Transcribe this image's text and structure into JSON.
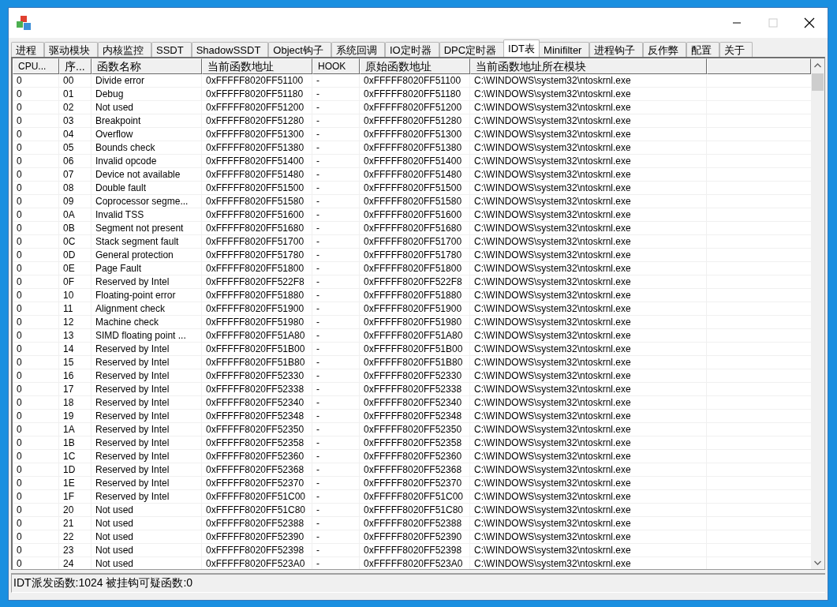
{
  "tabs": [
    {
      "label": "进程",
      "selected": false
    },
    {
      "label": "驱动模块",
      "selected": false
    },
    {
      "label": "内核监控",
      "selected": false
    },
    {
      "label": "SSDT",
      "selected": false
    },
    {
      "label": "ShadowSSDT",
      "selected": false
    },
    {
      "label": "Object钩子",
      "selected": false
    },
    {
      "label": "系统回调",
      "selected": false
    },
    {
      "label": "IO定时器",
      "selected": false
    },
    {
      "label": "DPC定时器",
      "selected": false
    },
    {
      "label": "IDT表",
      "selected": true
    },
    {
      "label": "Minifilter",
      "selected": false
    },
    {
      "label": "进程钩子",
      "selected": false
    },
    {
      "label": "反作弊",
      "selected": false
    },
    {
      "label": "配置",
      "selected": false
    },
    {
      "label": "关于",
      "selected": false
    }
  ],
  "table": {
    "columns": [
      "CPU...",
      "序...",
      "函数名称",
      "当前函数地址",
      "HOOK",
      "原始函数地址",
      "当前函数地址所在模块"
    ],
    "rows": [
      [
        "0",
        "00",
        "Divide error",
        "0xFFFFF8020FF51100",
        "-",
        "0xFFFFF8020FF51100",
        "C:\\WINDOWS\\system32\\ntoskrnl.exe"
      ],
      [
        "0",
        "01",
        "Debug",
        "0xFFFFF8020FF51180",
        "-",
        "0xFFFFF8020FF51180",
        "C:\\WINDOWS\\system32\\ntoskrnl.exe"
      ],
      [
        "0",
        "02",
        "Not used",
        "0xFFFFF8020FF51200",
        "-",
        "0xFFFFF8020FF51200",
        "C:\\WINDOWS\\system32\\ntoskrnl.exe"
      ],
      [
        "0",
        "03",
        "Breakpoint",
        "0xFFFFF8020FF51280",
        "-",
        "0xFFFFF8020FF51280",
        "C:\\WINDOWS\\system32\\ntoskrnl.exe"
      ],
      [
        "0",
        "04",
        "Overflow",
        "0xFFFFF8020FF51300",
        "-",
        "0xFFFFF8020FF51300",
        "C:\\WINDOWS\\system32\\ntoskrnl.exe"
      ],
      [
        "0",
        "05",
        "Bounds check",
        "0xFFFFF8020FF51380",
        "-",
        "0xFFFFF8020FF51380",
        "C:\\WINDOWS\\system32\\ntoskrnl.exe"
      ],
      [
        "0",
        "06",
        "Invalid opcode",
        "0xFFFFF8020FF51400",
        "-",
        "0xFFFFF8020FF51400",
        "C:\\WINDOWS\\system32\\ntoskrnl.exe"
      ],
      [
        "0",
        "07",
        "Device not available",
        "0xFFFFF8020FF51480",
        "-",
        "0xFFFFF8020FF51480",
        "C:\\WINDOWS\\system32\\ntoskrnl.exe"
      ],
      [
        "0",
        "08",
        "Double fault",
        "0xFFFFF8020FF51500",
        "-",
        "0xFFFFF8020FF51500",
        "C:\\WINDOWS\\system32\\ntoskrnl.exe"
      ],
      [
        "0",
        "09",
        "Coprocessor segme...",
        "0xFFFFF8020FF51580",
        "-",
        "0xFFFFF8020FF51580",
        "C:\\WINDOWS\\system32\\ntoskrnl.exe"
      ],
      [
        "0",
        "0A",
        "Invalid TSS",
        "0xFFFFF8020FF51600",
        "-",
        "0xFFFFF8020FF51600",
        "C:\\WINDOWS\\system32\\ntoskrnl.exe"
      ],
      [
        "0",
        "0B",
        "Segment not present",
        "0xFFFFF8020FF51680",
        "-",
        "0xFFFFF8020FF51680",
        "C:\\WINDOWS\\system32\\ntoskrnl.exe"
      ],
      [
        "0",
        "0C",
        "Stack segment fault",
        "0xFFFFF8020FF51700",
        "-",
        "0xFFFFF8020FF51700",
        "C:\\WINDOWS\\system32\\ntoskrnl.exe"
      ],
      [
        "0",
        "0D",
        "General protection",
        "0xFFFFF8020FF51780",
        "-",
        "0xFFFFF8020FF51780",
        "C:\\WINDOWS\\system32\\ntoskrnl.exe"
      ],
      [
        "0",
        "0E",
        "Page Fault",
        "0xFFFFF8020FF51800",
        "-",
        "0xFFFFF8020FF51800",
        "C:\\WINDOWS\\system32\\ntoskrnl.exe"
      ],
      [
        "0",
        "0F",
        "Reserved by Intel",
        "0xFFFFF8020FF522F8",
        "-",
        "0xFFFFF8020FF522F8",
        "C:\\WINDOWS\\system32\\ntoskrnl.exe"
      ],
      [
        "0",
        "10",
        "Floating-point error",
        "0xFFFFF8020FF51880",
        "-",
        "0xFFFFF8020FF51880",
        "C:\\WINDOWS\\system32\\ntoskrnl.exe"
      ],
      [
        "0",
        "11",
        "Alignment check",
        "0xFFFFF8020FF51900",
        "-",
        "0xFFFFF8020FF51900",
        "C:\\WINDOWS\\system32\\ntoskrnl.exe"
      ],
      [
        "0",
        "12",
        "Machine check",
        "0xFFFFF8020FF51980",
        "-",
        "0xFFFFF8020FF51980",
        "C:\\WINDOWS\\system32\\ntoskrnl.exe"
      ],
      [
        "0",
        "13",
        "SIMD floating point ...",
        "0xFFFFF8020FF51A80",
        "-",
        "0xFFFFF8020FF51A80",
        "C:\\WINDOWS\\system32\\ntoskrnl.exe"
      ],
      [
        "0",
        "14",
        "Reserved by Intel",
        "0xFFFFF8020FF51B00",
        "-",
        "0xFFFFF8020FF51B00",
        "C:\\WINDOWS\\system32\\ntoskrnl.exe"
      ],
      [
        "0",
        "15",
        "Reserved by Intel",
        "0xFFFFF8020FF51B80",
        "-",
        "0xFFFFF8020FF51B80",
        "C:\\WINDOWS\\system32\\ntoskrnl.exe"
      ],
      [
        "0",
        "16",
        "Reserved by Intel",
        "0xFFFFF8020FF52330",
        "-",
        "0xFFFFF8020FF52330",
        "C:\\WINDOWS\\system32\\ntoskrnl.exe"
      ],
      [
        "0",
        "17",
        "Reserved by Intel",
        "0xFFFFF8020FF52338",
        "-",
        "0xFFFFF8020FF52338",
        "C:\\WINDOWS\\system32\\ntoskrnl.exe"
      ],
      [
        "0",
        "18",
        "Reserved by Intel",
        "0xFFFFF8020FF52340",
        "-",
        "0xFFFFF8020FF52340",
        "C:\\WINDOWS\\system32\\ntoskrnl.exe"
      ],
      [
        "0",
        "19",
        "Reserved by Intel",
        "0xFFFFF8020FF52348",
        "-",
        "0xFFFFF8020FF52348",
        "C:\\WINDOWS\\system32\\ntoskrnl.exe"
      ],
      [
        "0",
        "1A",
        "Reserved by Intel",
        "0xFFFFF8020FF52350",
        "-",
        "0xFFFFF8020FF52350",
        "C:\\WINDOWS\\system32\\ntoskrnl.exe"
      ],
      [
        "0",
        "1B",
        "Reserved by Intel",
        "0xFFFFF8020FF52358",
        "-",
        "0xFFFFF8020FF52358",
        "C:\\WINDOWS\\system32\\ntoskrnl.exe"
      ],
      [
        "0",
        "1C",
        "Reserved by Intel",
        "0xFFFFF8020FF52360",
        "-",
        "0xFFFFF8020FF52360",
        "C:\\WINDOWS\\system32\\ntoskrnl.exe"
      ],
      [
        "0",
        "1D",
        "Reserved by Intel",
        "0xFFFFF8020FF52368",
        "-",
        "0xFFFFF8020FF52368",
        "C:\\WINDOWS\\system32\\ntoskrnl.exe"
      ],
      [
        "0",
        "1E",
        "Reserved by Intel",
        "0xFFFFF8020FF52370",
        "-",
        "0xFFFFF8020FF52370",
        "C:\\WINDOWS\\system32\\ntoskrnl.exe"
      ],
      [
        "0",
        "1F",
        "Reserved by Intel",
        "0xFFFFF8020FF51C00",
        "-",
        "0xFFFFF8020FF51C00",
        "C:\\WINDOWS\\system32\\ntoskrnl.exe"
      ],
      [
        "0",
        "20",
        "Not used",
        "0xFFFFF8020FF51C80",
        "-",
        "0xFFFFF8020FF51C80",
        "C:\\WINDOWS\\system32\\ntoskrnl.exe"
      ],
      [
        "0",
        "21",
        "Not used",
        "0xFFFFF8020FF52388",
        "-",
        "0xFFFFF8020FF52388",
        "C:\\WINDOWS\\system32\\ntoskrnl.exe"
      ],
      [
        "0",
        "22",
        "Not used",
        "0xFFFFF8020FF52390",
        "-",
        "0xFFFFF8020FF52390",
        "C:\\WINDOWS\\system32\\ntoskrnl.exe"
      ],
      [
        "0",
        "23",
        "Not used",
        "0xFFFFF8020FF52398",
        "-",
        "0xFFFFF8020FF52398",
        "C:\\WINDOWS\\system32\\ntoskrnl.exe"
      ],
      [
        "0",
        "24",
        "Not used",
        "0xFFFFF8020FF523A0",
        "-",
        "0xFFFFF8020FF523A0",
        "C:\\WINDOWS\\system32\\ntoskrnl.exe"
      ]
    ]
  },
  "status_bar": "IDT派发函数:1024 被挂钩可疑函数:0"
}
